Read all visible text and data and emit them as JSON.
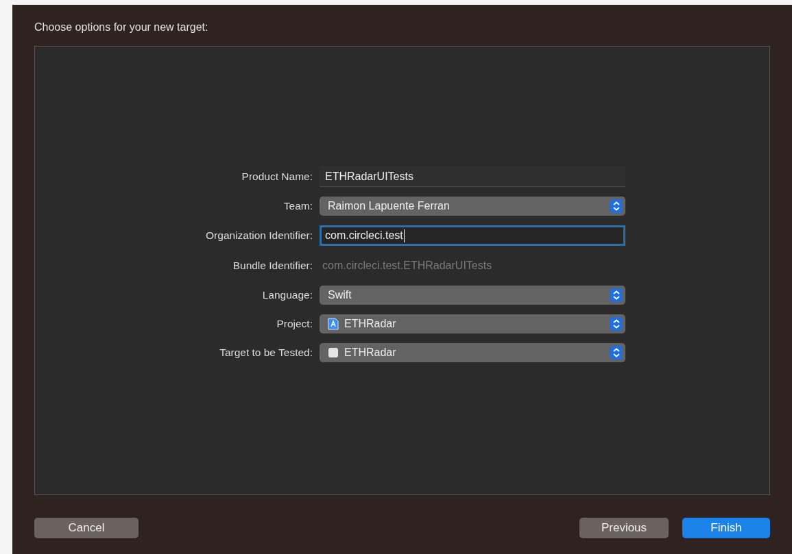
{
  "dialog": {
    "title": "Choose options for your new target:"
  },
  "fields": [
    {
      "label": "Product Name:",
      "kind": "text",
      "value": "ETHRadarUITests",
      "focused": false
    },
    {
      "label": "Team:",
      "kind": "popup",
      "value": "Raimon Lapuente Ferran"
    },
    {
      "label": "Organization Identifier:",
      "kind": "text",
      "value": "com.circleci.test",
      "focused": true
    },
    {
      "label": "Bundle Identifier:",
      "kind": "static",
      "value": "com.circleci.test.ETHRadarUITests"
    },
    {
      "label": "Language:",
      "kind": "popup",
      "value": "Swift"
    },
    {
      "label": "Project:",
      "kind": "project-popup",
      "value": "ETHRadar"
    },
    {
      "label": "Target to be Tested:",
      "kind": "target-popup",
      "value": "ETHRadar"
    }
  ],
  "buttons": [
    {
      "label": "Cancel",
      "primary": false
    },
    {
      "label": "Previous",
      "primary": false
    },
    {
      "label": "Finish",
      "primary": true
    }
  ]
}
